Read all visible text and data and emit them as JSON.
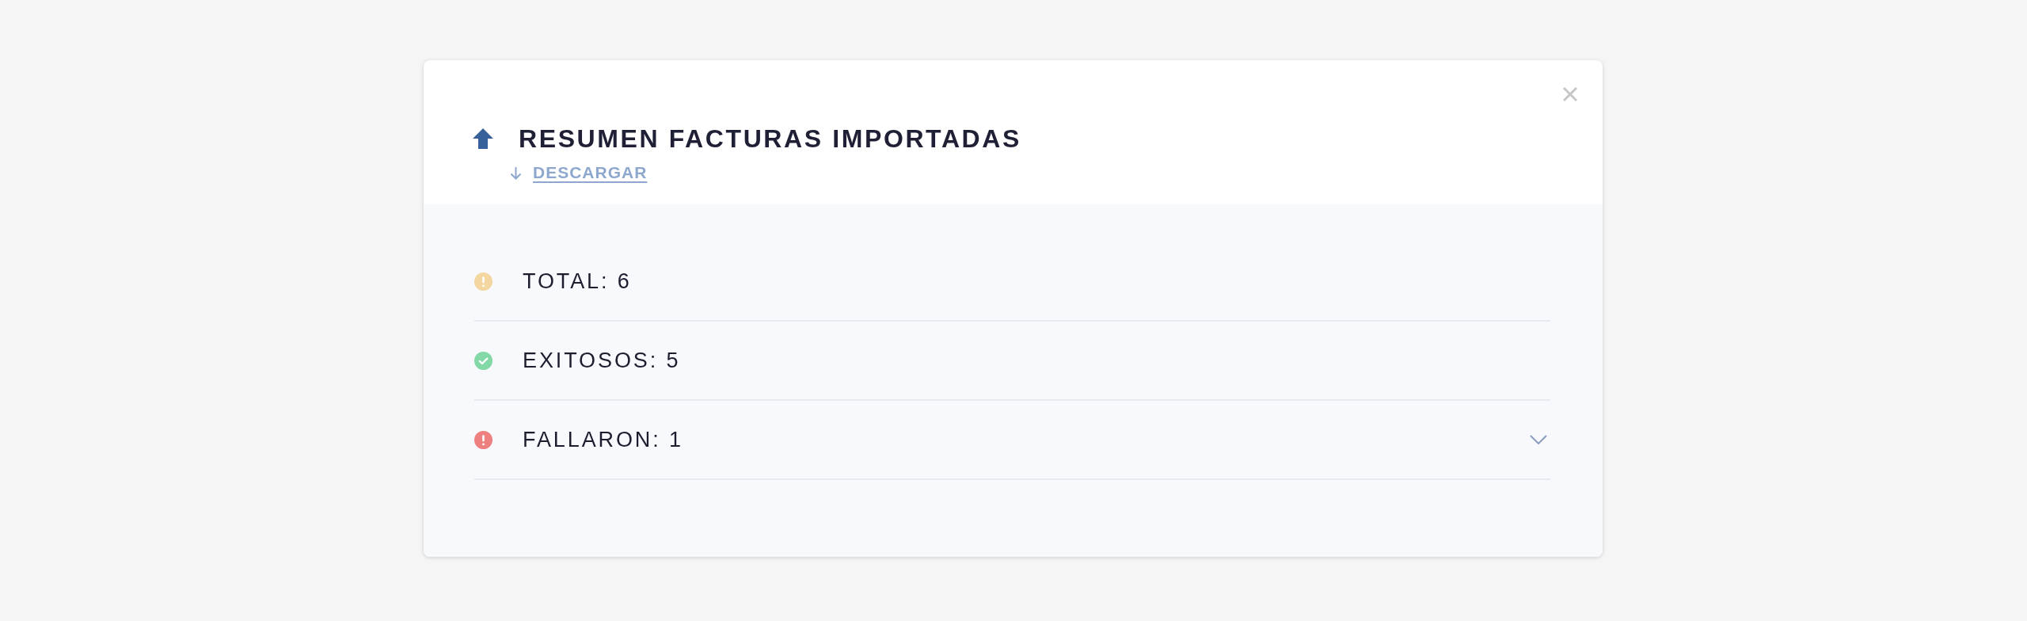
{
  "dialog": {
    "title": "RESUMEN FACTURAS IMPORTADAS",
    "download_link": "DESCARGAR"
  },
  "summary_rows": [
    {
      "kind": "warning",
      "color": "#f3d6a0",
      "label": "TOTAL: 6"
    },
    {
      "kind": "success",
      "color": "#82d9a6",
      "label": "EXITOSOS: 5"
    },
    {
      "kind": "error",
      "color": "#ee8080",
      "label": "FALLARON: 1",
      "expanded": false
    }
  ]
}
